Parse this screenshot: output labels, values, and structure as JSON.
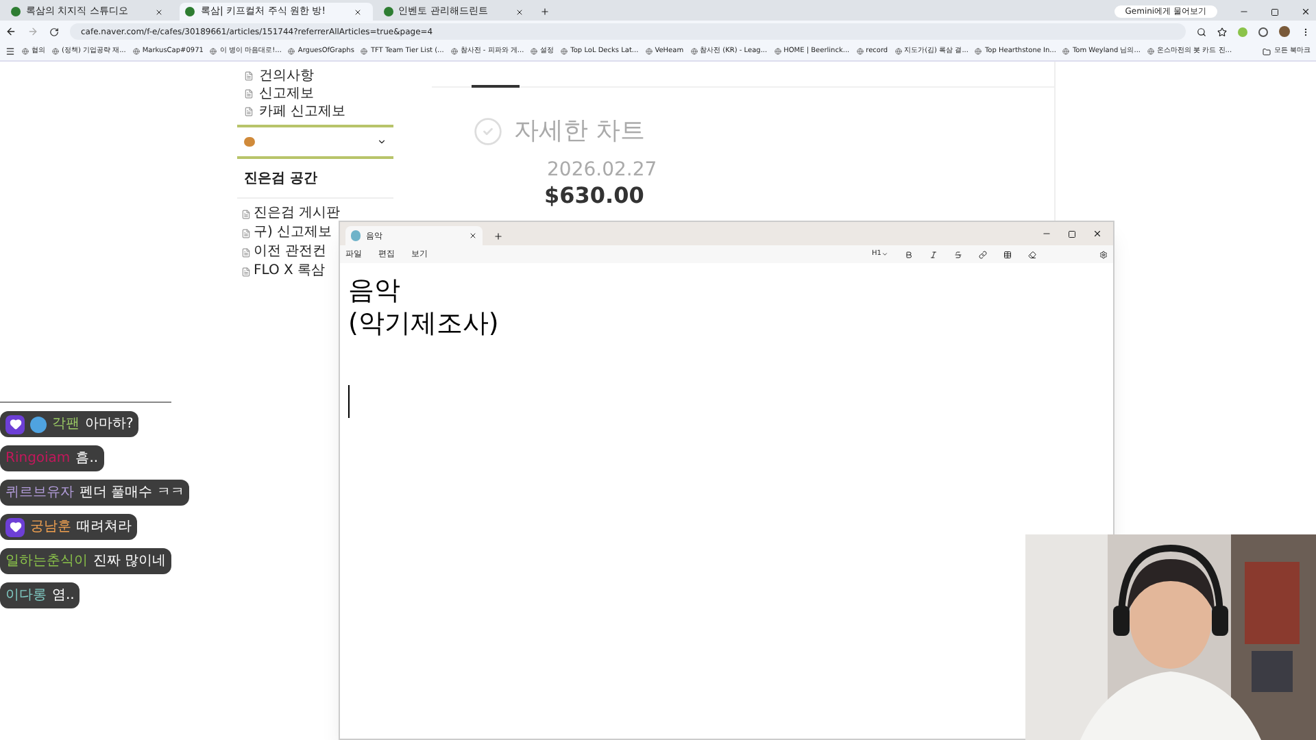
{
  "browser": {
    "tabs": [
      {
        "title": "록삼의 치지직 스튜디오",
        "selected": false
      },
      {
        "title": "록삼| 키프컬처 주식 원한 방!",
        "selected": true
      },
      {
        "title": "인벤토 관리해드린트",
        "selected": false
      }
    ],
    "address": "cafe.naver.com/f-e/cafes/30189661/articles/151744?referrerAllArticles=true&page=4",
    "gemini_button": "Gemini에게 물어보기",
    "bookmarks": [
      "협의",
      "(정책) 기업공략 재...",
      "MarkusCap#0971",
      "이 병이 마음대로!...",
      "ArguesOfGraphs",
      "TFT Team Tier List (...",
      "참사전 - 피파와 게...",
      "설정",
      "Top LoL Decks Lat...",
      "VeHeam",
      "참사전 (KR) - Leag...",
      "HOME | Beerlinck...",
      "record",
      "지도가(김) 록삼 결...",
      "Top Hearthstone In...",
      "Tom Weyland 님의...",
      "온스마전의 봇 카드 진..."
    ],
    "other_bookmarks": "모든 북마크"
  },
  "sidebar": {
    "top_items": [
      "건의사항",
      "신고제보",
      "카페 신고제보"
    ],
    "section_title": "진은검 공간",
    "section_items": [
      "진은검 게시판",
      "구) 신고제보",
      "이전 관전컨",
      "FLO X 록삼"
    ]
  },
  "article": {
    "heading": "자세한 차트",
    "date": "2026.02.27",
    "price": "$630.00"
  },
  "notepad": {
    "tabs": [
      {
        "title": "음악",
        "selected": true
      }
    ],
    "menu": [
      "파일",
      "편집",
      "보기"
    ],
    "heading_level": "H1",
    "lines": [
      "음악",
      "(악기제조사)"
    ]
  },
  "chat": [
    {
      "heart_badge": true,
      "emote_badge": true,
      "name": "각팬",
      "color": "#9ccc65",
      "text": "아마하?"
    },
    {
      "heart_badge": false,
      "emote_badge": false,
      "name": "Ringoiam",
      "color": "#c2185b",
      "text": "흠.."
    },
    {
      "heart_badge": false,
      "emote_badge": false,
      "name": "퀴르브유자",
      "color": "#b39ddb",
      "text": "펜더 풀매수 ㅋㅋ"
    },
    {
      "heart_badge": true,
      "emote_badge": false,
      "name": "궁남훈",
      "color": "#f0a050",
      "text": "때려쳐라"
    },
    {
      "heart_badge": false,
      "emote_badge": false,
      "name": "일하는춘식이",
      "color": "#8bc34a",
      "text": "진짜 많이네"
    },
    {
      "heart_badge": false,
      "emote_badge": false,
      "name": "이다롱",
      "color": "#80cbc4",
      "text": "염.."
    }
  ]
}
